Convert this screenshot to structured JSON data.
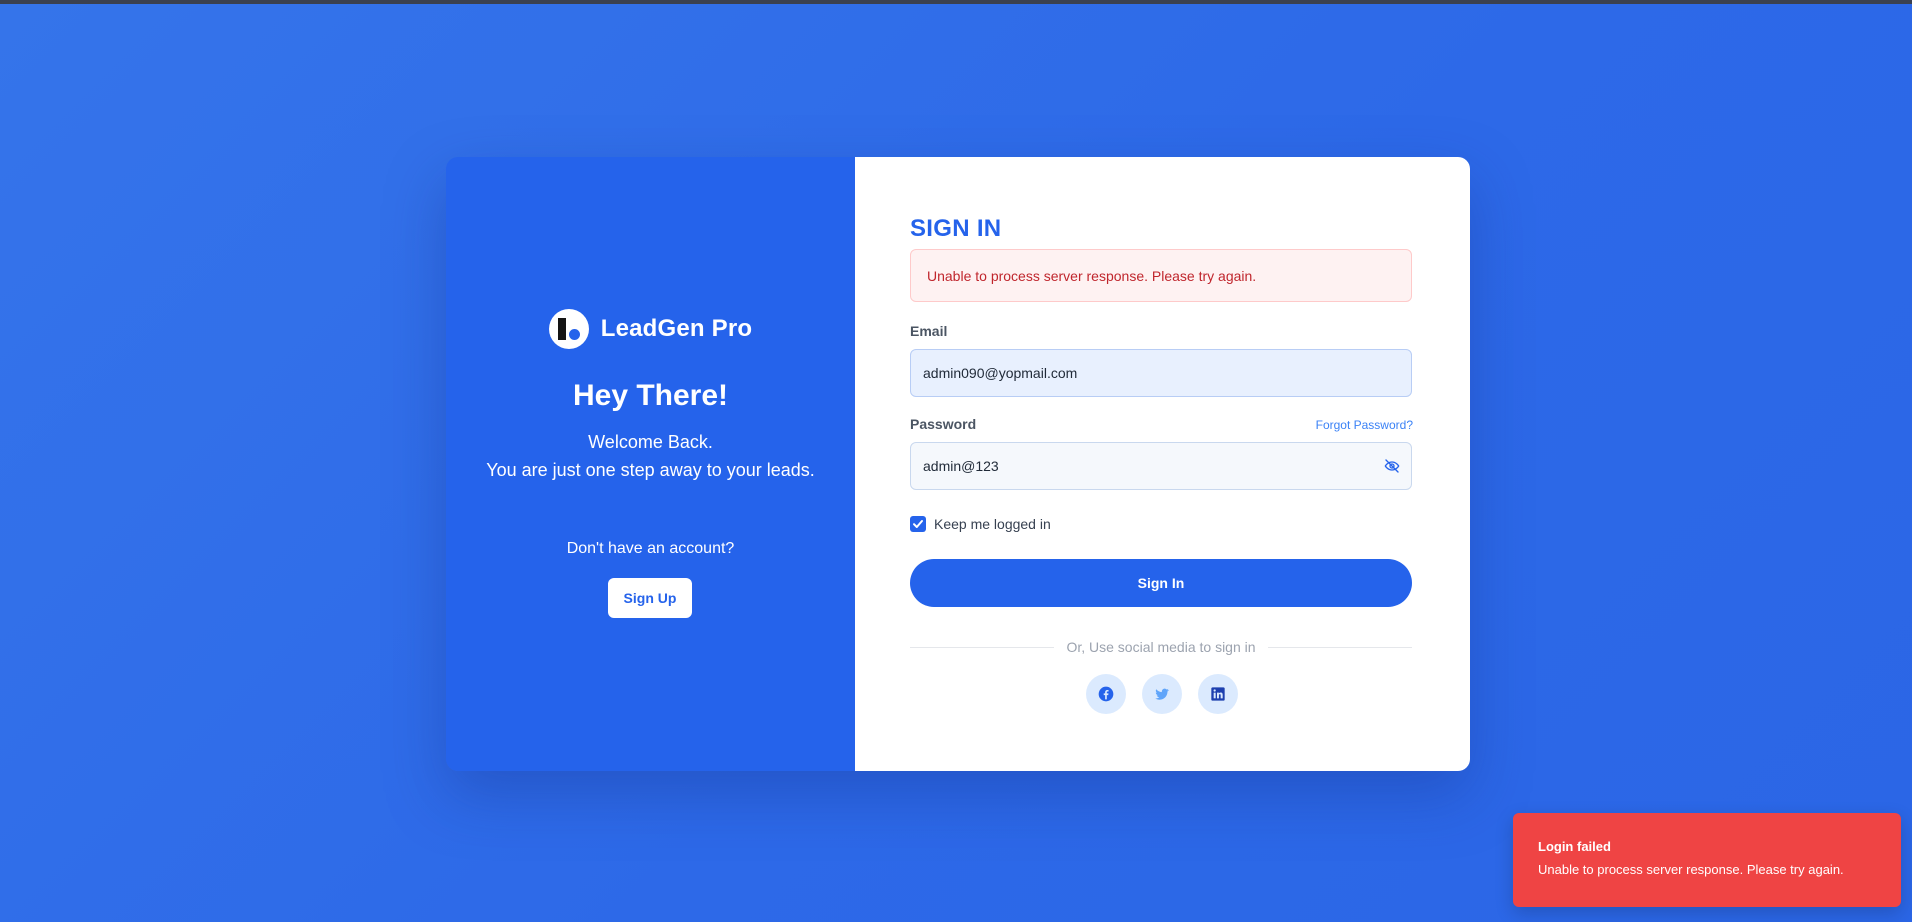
{
  "brand": {
    "name": "LeadGen Pro",
    "logo_icon": "leadgen-logo"
  },
  "left": {
    "heading": "Hey There!",
    "welcome_line1": "Welcome Back.",
    "welcome_line2": "You are just one step away to your leads.",
    "no_account": "Don't have an account?",
    "signup_label": "Sign Up"
  },
  "form": {
    "title": "SIGN IN",
    "error_message": "Unable to process server response. Please try again.",
    "email_label": "Email",
    "email_value": "admin090@yopmail.com",
    "password_label": "Password",
    "forgot_label": "Forgot Password?",
    "password_value": "admin@123",
    "password_visibility_icon": "eye-off-icon",
    "keep_logged_in_label": "Keep me logged in",
    "keep_logged_in_checked": true,
    "signin_label": "Sign In",
    "social_divider": "Or, Use social media to sign in",
    "social_icons": [
      "facebook-icon",
      "twitter-icon",
      "linkedin-icon"
    ]
  },
  "toast": {
    "title": "Login failed",
    "message": "Unable to process server response. Please try again."
  },
  "colors": {
    "background": "#2f6de9",
    "primary": "#2563eb",
    "error_toast": "#ef4444",
    "error_text": "#c0262d",
    "link": "#3b82f6"
  }
}
